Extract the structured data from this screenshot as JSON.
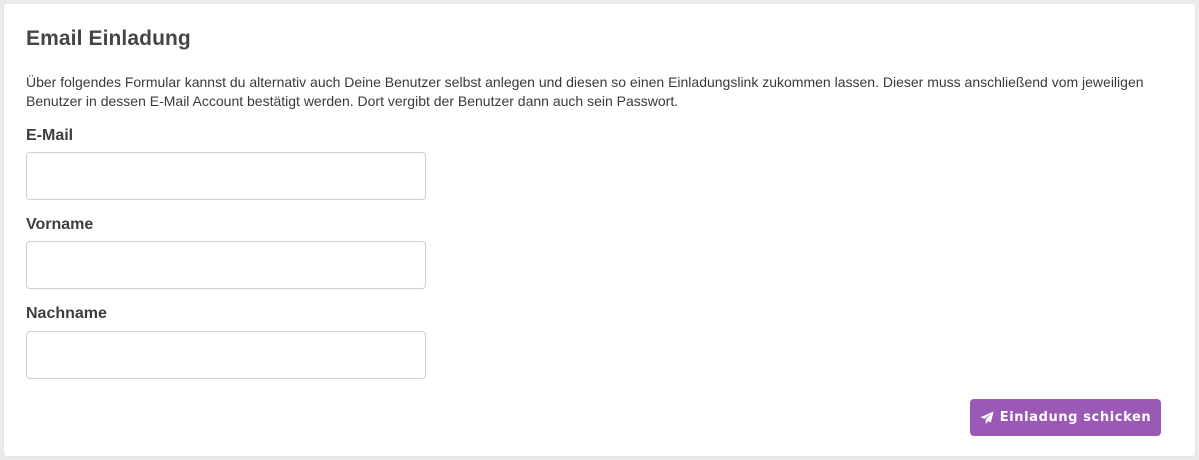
{
  "card": {
    "title": "Email Einladung",
    "description": "Über folgendes Formular kannst du alternativ auch Deine Benutzer selbst anlegen und diesen so einen Einladungslink zukommen lassen. Dieser muss anschließend vom jeweiligen Benutzer in dessen E-Mail Account bestätigt werden. Dort vergibt der Benutzer dann auch sein Passwort."
  },
  "form": {
    "email": {
      "label": "E-Mail",
      "value": ""
    },
    "first_name": {
      "label": "Vorname",
      "value": ""
    },
    "last_name": {
      "label": "Nachname",
      "value": ""
    },
    "submit": {
      "label": "Einladung schicken",
      "icon": "paper-plane-icon"
    }
  },
  "colors": {
    "accent": "#9b59b6",
    "background": "#ebebeb",
    "card": "#ffffff",
    "input_border": "#cfcfcf"
  }
}
